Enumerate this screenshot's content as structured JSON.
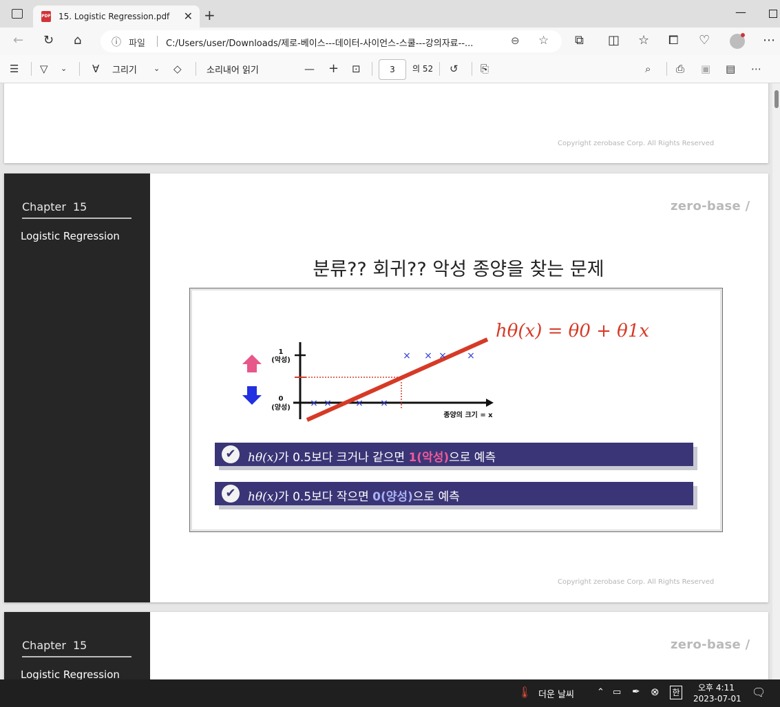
{
  "browser": {
    "tab_title": "15. Logistic Regression.pdf",
    "tab_close": "✕",
    "new_tab": "+",
    "address_label": "파일",
    "url": "C:/Users/user/Downloads/제로-베이스---데이터-사이언스-스쿨---강의자료--..."
  },
  "pdf_toolbar": {
    "draw_label": "그리기",
    "read_aloud_label": "소리내어 읽기",
    "current_page": "3",
    "total_pages": "의 52"
  },
  "pages": {
    "top_copyright": "Copyright zerobase Corp. All Rights Reserved",
    "chapter_label": "Chapter",
    "chapter_number": "15",
    "chapter_subtitle": "Logistic Regression",
    "logo": "zero-base",
    "logo_slash": "/",
    "slide_title": "분류?? 회귀?? 악성 종양을 찾는 문제",
    "slide_copyright": "Copyright zerobase Corp. All Rights Reserved",
    "next_chapter_label": "Chapter",
    "next_chapter_number": "15",
    "next_chapter_subtitle": "Logistic Regression",
    "next_logo": "zero-base",
    "next_logo_slash": "/"
  },
  "figure": {
    "formula": "hθ(x) = θ0 + θ1x",
    "y_tick_top": "1",
    "y_tick_top_label": "(악성)",
    "y_tick_bottom": "0",
    "y_tick_bottom_label": "(양성)",
    "x_axis_label": "종양의 크기 = x",
    "point_marker": "×",
    "bar1_prefix": "hθ(x)",
    "bar1_text": "가 0.5보다 크거나 같으면 ",
    "bar1_highlight": "1(악성)",
    "bar1_suffix": "으로 예측",
    "bar2_prefix": "hθ(x)",
    "bar2_text": "가 0.5보다 작으면 ",
    "bar2_highlight": "0(양성)",
    "bar2_suffix": "으로 예측",
    "colors": {
      "regression_line": "#d63a26",
      "points": "#2b3bd6",
      "bar": "#3a3576",
      "up_arrow": "#e8578a",
      "down_arrow": "#2130e0"
    }
  },
  "taskbar": {
    "weather": "더운 날씨",
    "ime": "한",
    "time": "오후 4:11",
    "date": "2023-07-01"
  }
}
